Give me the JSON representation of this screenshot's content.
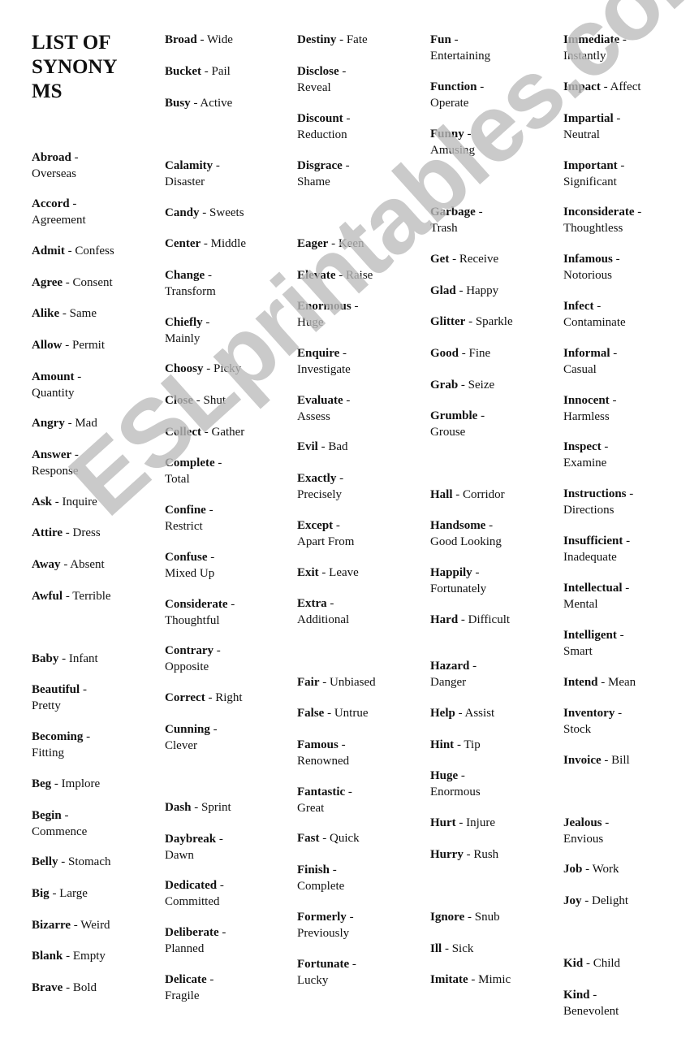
{
  "title": "LIST OF SYNONY MS",
  "title_lines": [
    "LIST OF",
    "SYNONY",
    "MS"
  ],
  "watermark": "ESLprintables.com",
  "columns": [
    {
      "entries": [
        {
          "word": "Abroad",
          "synonym": "Overseas"
        },
        {
          "word": "Accord",
          "synonym": "Agreement"
        },
        {
          "word": "Admit",
          "synonym": "Confess"
        },
        {
          "word": "Agree",
          "synonym": "Consent"
        },
        {
          "word": "Alike",
          "synonym": "Same"
        },
        {
          "word": "Allow",
          "synonym": "Permit"
        },
        {
          "word": "Amount",
          "synonym": "Quantity"
        },
        {
          "word": "Angry",
          "synonym": "Mad"
        },
        {
          "word": "Answer",
          "synonym": "Response"
        },
        {
          "word": "Ask",
          "synonym": "Inquire"
        },
        {
          "word": "Attire",
          "synonym": "Dress"
        },
        {
          "word": "Away",
          "synonym": "Absent"
        },
        {
          "word": "Awful",
          "synonym": "Terrible"
        },
        {
          "word": "Baby",
          "synonym": "Infant"
        },
        {
          "word": "Beautiful",
          "synonym": "Pretty"
        },
        {
          "word": "Becoming",
          "synonym": "Fitting"
        },
        {
          "word": "Beg",
          "synonym": "Implore"
        },
        {
          "word": "Begin",
          "synonym": "Commence"
        },
        {
          "word": "Belly",
          "synonym": "Stomach"
        },
        {
          "word": "Big",
          "synonym": "Large"
        },
        {
          "word": "Bizarre",
          "synonym": "Weird"
        },
        {
          "word": "Blank",
          "synonym": "Empty"
        },
        {
          "word": "Brave",
          "synonym": "Bold"
        }
      ]
    },
    {
      "entries": [
        {
          "word": "Broad",
          "synonym": "Wide"
        },
        {
          "word": "Bucket",
          "synonym": "Pail"
        },
        {
          "word": "Busy",
          "synonym": "Active"
        },
        {
          "word": "Calamity",
          "synonym": "Disaster"
        },
        {
          "word": "Candy",
          "synonym": "Sweets"
        },
        {
          "word": "Center",
          "synonym": "Middle"
        },
        {
          "word": "Change",
          "synonym": "Transform"
        },
        {
          "word": "Chiefly",
          "synonym": "Mainly"
        },
        {
          "word": "Choosy",
          "synonym": "Picky"
        },
        {
          "word": "Close",
          "synonym": "Shut"
        },
        {
          "word": "Collect",
          "synonym": "Gather"
        },
        {
          "word": "Complete",
          "synonym": "Total"
        },
        {
          "word": "Confine",
          "synonym": "Restrict"
        },
        {
          "word": "Confuse",
          "synonym": "Mixed Up"
        },
        {
          "word": "Considerate",
          "synonym": "Thoughtful"
        },
        {
          "word": "Contrary",
          "synonym": "Opposite"
        },
        {
          "word": "Correct",
          "synonym": "Right"
        },
        {
          "word": "Cunning",
          "synonym": "Clever"
        },
        {
          "word": "Dash",
          "synonym": "Sprint"
        },
        {
          "word": "Daybreak",
          "synonym": "Dawn"
        },
        {
          "word": "Dedicated",
          "synonym": "Committed"
        },
        {
          "word": "Deliberate",
          "synonym": "Planned"
        },
        {
          "word": "Delicate",
          "synonym": "Fragile"
        }
      ]
    },
    {
      "entries": [
        {
          "word": "Destiny",
          "synonym": "Fate"
        },
        {
          "word": "Disclose",
          "synonym": "Reveal"
        },
        {
          "word": "Discount",
          "synonym": "Reduction"
        },
        {
          "word": "Disgrace",
          "synonym": "Shame"
        },
        {
          "word": "Eager",
          "synonym": "Keen"
        },
        {
          "word": "Elevate",
          "synonym": "Raise"
        },
        {
          "word": "Enormous",
          "synonym": "Huge"
        },
        {
          "word": "Enquire",
          "synonym": "Investigate"
        },
        {
          "word": "Evaluate",
          "synonym": "Assess"
        },
        {
          "word": "Evil",
          "synonym": "Bad"
        },
        {
          "word": "Exactly",
          "synonym": "Precisely"
        },
        {
          "word": "Except",
          "synonym": "Apart From"
        },
        {
          "word": "Exit",
          "synonym": "Leave"
        },
        {
          "word": "Extra",
          "synonym": "Additional"
        },
        {
          "word": "Fair",
          "synonym": "Unbiased"
        },
        {
          "word": "False",
          "synonym": "Untrue"
        },
        {
          "word": "Famous",
          "synonym": "Renowned"
        },
        {
          "word": "Fantastic",
          "synonym": "Great"
        },
        {
          "word": "Fast",
          "synonym": "Quick"
        },
        {
          "word": "Finish",
          "synonym": "Complete"
        },
        {
          "word": "Formerly",
          "synonym": "Previously"
        },
        {
          "word": "Fortunate",
          "synonym": "Lucky"
        }
      ]
    },
    {
      "entries": [
        {
          "word": "Fun",
          "synonym": "Entertaining"
        },
        {
          "word": "Function",
          "synonym": "Operate"
        },
        {
          "word": "Funny",
          "synonym": "Amusing"
        },
        {
          "word": "Garbage",
          "synonym": "Trash"
        },
        {
          "word": "Get",
          "synonym": "Receive"
        },
        {
          "word": "Glad",
          "synonym": "Happy"
        },
        {
          "word": "Glitter",
          "synonym": "Sparkle"
        },
        {
          "word": "Good",
          "synonym": "Fine"
        },
        {
          "word": "Grab",
          "synonym": "Seize"
        },
        {
          "word": "Grumble",
          "synonym": "Grouse"
        },
        {
          "word": "Hall",
          "synonym": "Corridor"
        },
        {
          "word": "Handsome",
          "synonym": "Good Looking"
        },
        {
          "word": "Happily",
          "synonym": "Fortunately"
        },
        {
          "word": "Hard",
          "synonym": "Difficult"
        },
        {
          "word": "Hazard",
          "synonym": "Danger"
        },
        {
          "word": "Help",
          "synonym": "Assist"
        },
        {
          "word": "Hint",
          "synonym": "Tip"
        },
        {
          "word": "Huge",
          "synonym": "Enormous"
        },
        {
          "word": "Hurt",
          "synonym": "Injure"
        },
        {
          "word": "Hurry",
          "synonym": "Rush"
        },
        {
          "word": "Ignore",
          "synonym": "Snub"
        },
        {
          "word": "Ill",
          "synonym": "Sick"
        },
        {
          "word": "Imitate",
          "synonym": "Mimic"
        }
      ]
    },
    {
      "entries": [
        {
          "word": "Immediate",
          "synonym": "Instantly"
        },
        {
          "word": "Impact",
          "synonym": "Affect"
        },
        {
          "word": "Impartial",
          "synonym": "Neutral"
        },
        {
          "word": "Important",
          "synonym": "Significant"
        },
        {
          "word": "Inconsiderate",
          "synonym": "Thoughtless"
        },
        {
          "word": "Infamous",
          "synonym": "Notorious"
        },
        {
          "word": "Infect",
          "synonym": "Contaminate"
        },
        {
          "word": "Informal",
          "synonym": "Casual"
        },
        {
          "word": "Innocent",
          "synonym": "Harmless"
        },
        {
          "word": "Inspect",
          "synonym": "Examine"
        },
        {
          "word": "Instructions",
          "synonym": "Directions"
        },
        {
          "word": "Insufficient",
          "synonym": "Inadequate"
        },
        {
          "word": "Intellectual",
          "synonym": "Mental"
        },
        {
          "word": "Intelligent",
          "synonym": "Smart"
        },
        {
          "word": "Intend",
          "synonym": "Mean"
        },
        {
          "word": "Inventory",
          "synonym": "Stock"
        },
        {
          "word": "Invoice",
          "synonym": "Bill"
        },
        {
          "word": "Jealous",
          "synonym": "Envious"
        },
        {
          "word": "Job",
          "synonym": "Work"
        },
        {
          "word": "Joy",
          "synonym": "Delight"
        },
        {
          "word": "Kid",
          "synonym": "Child"
        },
        {
          "word": "Kind",
          "synonym": "Benevolent"
        }
      ]
    }
  ]
}
